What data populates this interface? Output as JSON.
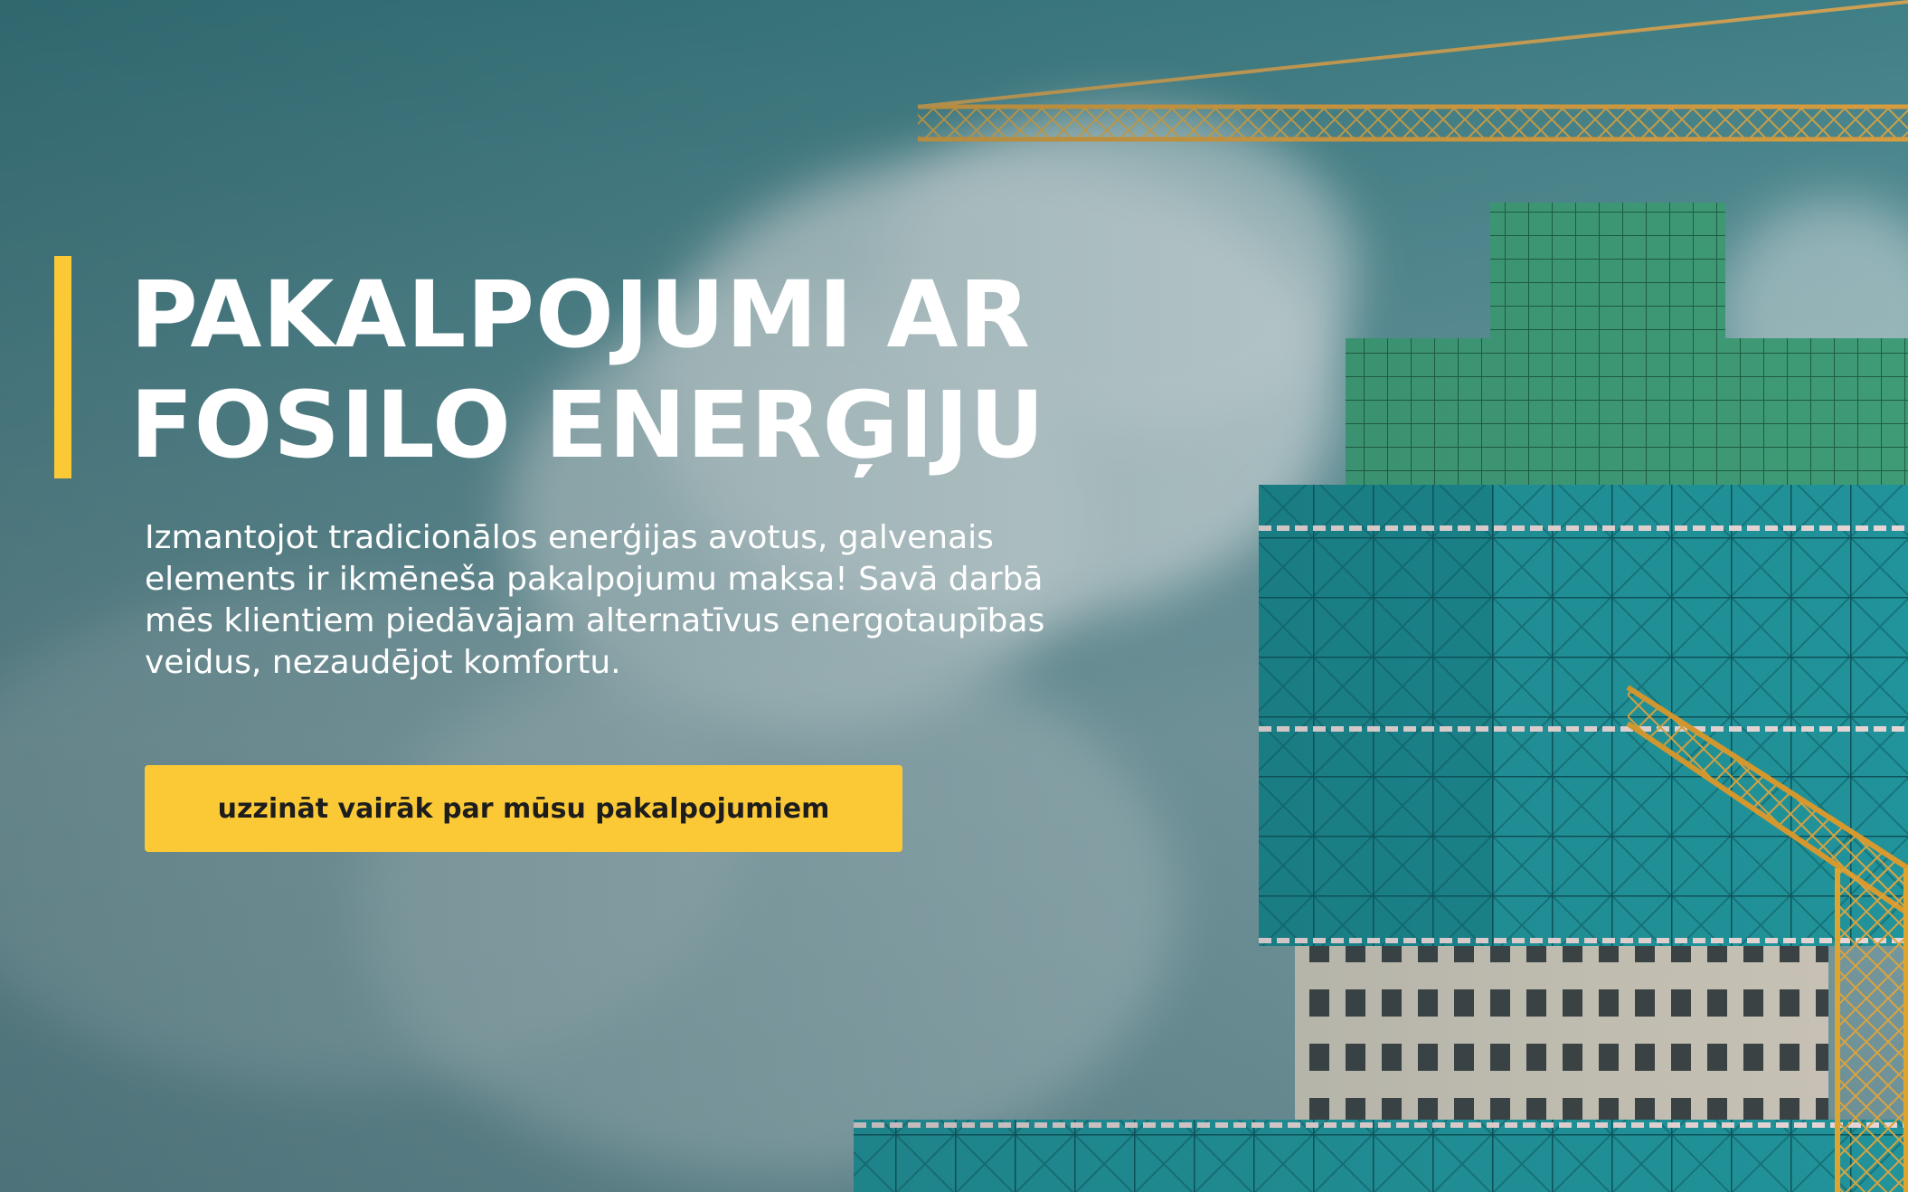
{
  "hero": {
    "title": "PAKALPOJUMI AR FOSILO ENERĢIJU",
    "description": "Izmantojot tradicionālos enerģijas avotus, galvenais elements ir ikmēneša pakalpojumu maksa! Savā darbā mēs klientiem piedāvājam alternatīvus energotaupības veidus, nezaudējot komfortu.",
    "cta_label": "uzzināt vairāk par mūsu pakalpojumiem",
    "background_image": "construction-building-with-cranes"
  },
  "colors": {
    "accent": "#fcc936",
    "text": "#ffffff",
    "button_text": "#1d1d1d",
    "sky": "#4f8a90",
    "building_net": "#1f8f95"
  }
}
